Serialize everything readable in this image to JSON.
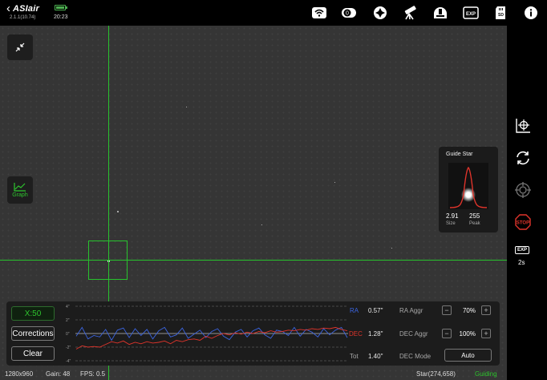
{
  "app": {
    "brand": "ASIair",
    "version": "2.1.1(10.74)",
    "time": "20:23",
    "battery_level": 0.85
  },
  "toolbar_icons": [
    "wifi-icon",
    "storage-toggle-icon",
    "focuser-icon",
    "telescope-icon",
    "observatory-icon",
    "exposure-settings-icon",
    "sd-card-icon",
    "info-icon"
  ],
  "viewport": {
    "graph_button_label": "Graph"
  },
  "guide_star": {
    "title": "Guide Star",
    "size_value": "2.91",
    "size_label": "Size",
    "peak_value": "255",
    "peak_label": "Peak"
  },
  "sidebar": {
    "exposure_badge": "EXP",
    "exposure_value": "2s",
    "stop_label": "STOP"
  },
  "guide_panel": {
    "scale_button": "X:50",
    "corrections_button": "Corrections",
    "clear_button": "Clear",
    "y_ticks": [
      "4\"",
      "2\"",
      "0\"",
      "-2\"",
      "-4\""
    ],
    "ra_label": "RA",
    "ra_value": "0.57\"",
    "dec_label": "DEC",
    "dec_value": "1.28\"",
    "tot_label": "Tot",
    "tot_value": "1.40\"",
    "ra_aggr_label": "RA Aggr",
    "ra_aggr_value": "70%",
    "dec_aggr_label": "DEC Aggr",
    "dec_aggr_value": "100%",
    "dec_mode_label": "DEC Mode",
    "dec_mode_value": "Auto",
    "minus": "−",
    "plus": "+"
  },
  "status": {
    "resolution": "1280x960",
    "gain": "Gain: 48",
    "fps": "FPS: 0.5",
    "star": "Star(274,658)",
    "state": "Guiding"
  },
  "colors": {
    "crosshair": "#27c22d",
    "ra": "#3b64e0",
    "dec": "#e0342b",
    "guiding": "#2ec52e"
  },
  "chart_data": {
    "type": "line",
    "ylim": [
      -4,
      4
    ],
    "y_ticks": [
      4,
      2,
      0,
      -2,
      -4
    ],
    "series": [
      {
        "name": "RA",
        "values": [
          -0.4,
          0.9,
          -0.8,
          -0.3,
          -0.5,
          0.6,
          -1.0,
          0.5,
          0.8,
          -0.6,
          0.7,
          -0.3,
          0.6,
          -0.8,
          0.4,
          0.9,
          -0.5,
          -0.2,
          0.8,
          -0.7,
          -0.1,
          0.5,
          -0.6,
          0.3,
          0.7,
          -0.4,
          -0.9,
          0.2,
          0.6,
          -0.5,
          0.4,
          0.8,
          -0.2,
          -0.7,
          0.5,
          0.3,
          -0.3,
          0.9,
          -0.4,
          0.6,
          0.2,
          -0.5,
          0.7,
          -0.2,
          0.5,
          0.9,
          -0.6
        ]
      },
      {
        "name": "DEC",
        "values": [
          -2.3,
          -1.8,
          -2.0,
          -1.9,
          -2.0,
          -1.6,
          -1.2,
          -1.4,
          -1.1,
          -1.6,
          -1.3,
          -1.5,
          -1.2,
          -1.4,
          -1.3,
          -1.1,
          -1.5,
          -1.0,
          -1.2,
          -0.9,
          -0.8,
          -1.0,
          -0.4,
          -0.7,
          -0.3,
          0.0,
          -0.2,
          0.1,
          -0.1,
          0.2,
          0.0,
          0.3,
          0.1,
          0.4,
          0.2,
          0.3,
          0.5,
          0.4,
          0.6,
          0.5,
          0.7,
          0.6,
          0.8,
          0.7,
          0.9,
          0.6,
          0.4
        ]
      }
    ]
  }
}
